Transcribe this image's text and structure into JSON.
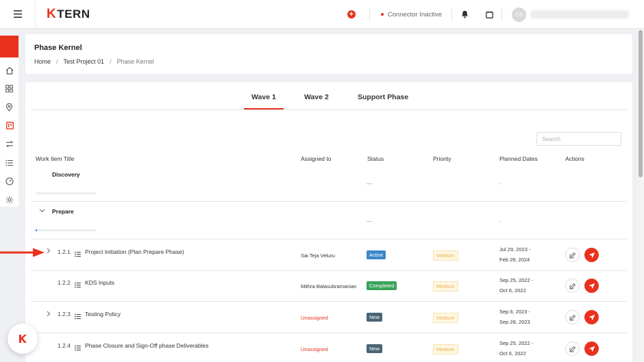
{
  "topbar": {
    "logo_accent": "K",
    "logo_text": "TERN",
    "connector_status": "Connector Inactive",
    "avatar_initials": "CS"
  },
  "header": {
    "title": "Phase Kernel",
    "breadcrumb": [
      "Home",
      "Test Project 01",
      "Phase Kernel"
    ],
    "separator": "/"
  },
  "tabs": [
    "Wave 1",
    "Wave 2",
    "Support Phase"
  ],
  "search": {
    "placeholder": "Search"
  },
  "table": {
    "columns": [
      "Work Item Title",
      "Assigned to",
      "Status",
      "Priority",
      "Planned Dates",
      "Actions"
    ],
    "phases": [
      {
        "title": "Discovery",
        "status": "—",
        "dates": "-",
        "progress": 0
      },
      {
        "title": "Prepare",
        "status": "—",
        "dates": "-",
        "progress": 0.02
      }
    ],
    "items": [
      {
        "number": "1.2.1",
        "title": "Project Initiation (Plan Prepare Phase)",
        "assignee": "Sai Teja Veluru",
        "status": "Active",
        "priority": "Medium",
        "date_start": "Jul 29, 2023 -",
        "date_end": "Feb 29, 2024"
      },
      {
        "number": "1.2.2",
        "title": "KDS Inputs",
        "assignee": "Mithra Balasubramanian",
        "status": "Completed",
        "priority": "Medium",
        "date_start": "Sep 25, 2022 -",
        "date_end": "Oct 6, 2022"
      },
      {
        "number": "1.2.3",
        "title": "Testing Policy",
        "assignee": "Unassigned",
        "status": "New",
        "priority": "Medium",
        "date_start": "Sep 6, 2023 -",
        "date_end": "Sep 28, 2023"
      },
      {
        "number": "1.2.4",
        "title": "Phase Closure and Sign-Off phase Deliverables",
        "assignee": "Unassigned",
        "status": "New",
        "priority": "Medium",
        "date_start": "Sep 25, 2022 -",
        "date_end": "Oct 6, 2022"
      }
    ]
  },
  "colors": {
    "accent": "#e8321e",
    "active": "#3a87c8",
    "completed": "#3aa35a",
    "new": "#4a6475",
    "priority": "#e9b44c"
  }
}
